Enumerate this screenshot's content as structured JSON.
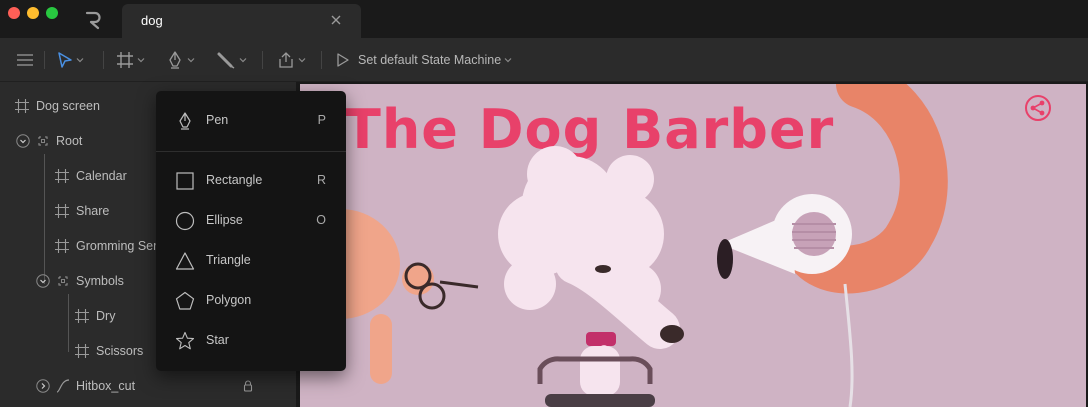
{
  "window": {
    "tab_title": "dog"
  },
  "toolbar": {
    "state_machine_label": "Set default State Machine"
  },
  "sidebar": {
    "items": [
      {
        "label": "Dog screen"
      },
      {
        "label": "Root"
      },
      {
        "label": "Calendar"
      },
      {
        "label": "Share"
      },
      {
        "label": "Gromming Serv"
      },
      {
        "label": "Symbols"
      },
      {
        "label": "Dry"
      },
      {
        "label": "Scissors"
      },
      {
        "label": "Hitbox_cut"
      }
    ]
  },
  "dropdown": {
    "items": [
      {
        "label": "Pen",
        "shortcut": "P",
        "icon": "pen-icon"
      },
      {
        "label": "Rectangle",
        "shortcut": "R",
        "icon": "rectangle-icon"
      },
      {
        "label": "Ellipse",
        "shortcut": "O",
        "icon": "ellipse-icon"
      },
      {
        "label": "Triangle",
        "shortcut": "",
        "icon": "triangle-icon"
      },
      {
        "label": "Polygon",
        "shortcut": "",
        "icon": "polygon-icon"
      },
      {
        "label": "Star",
        "shortcut": "",
        "icon": "star-icon"
      }
    ]
  },
  "artboard": {
    "title": "The Dog Barber"
  },
  "colors": {
    "accent_blue": "#4a90e2",
    "brand_pink": "#e8416a",
    "artboard_bg": "#cfb3c4"
  }
}
